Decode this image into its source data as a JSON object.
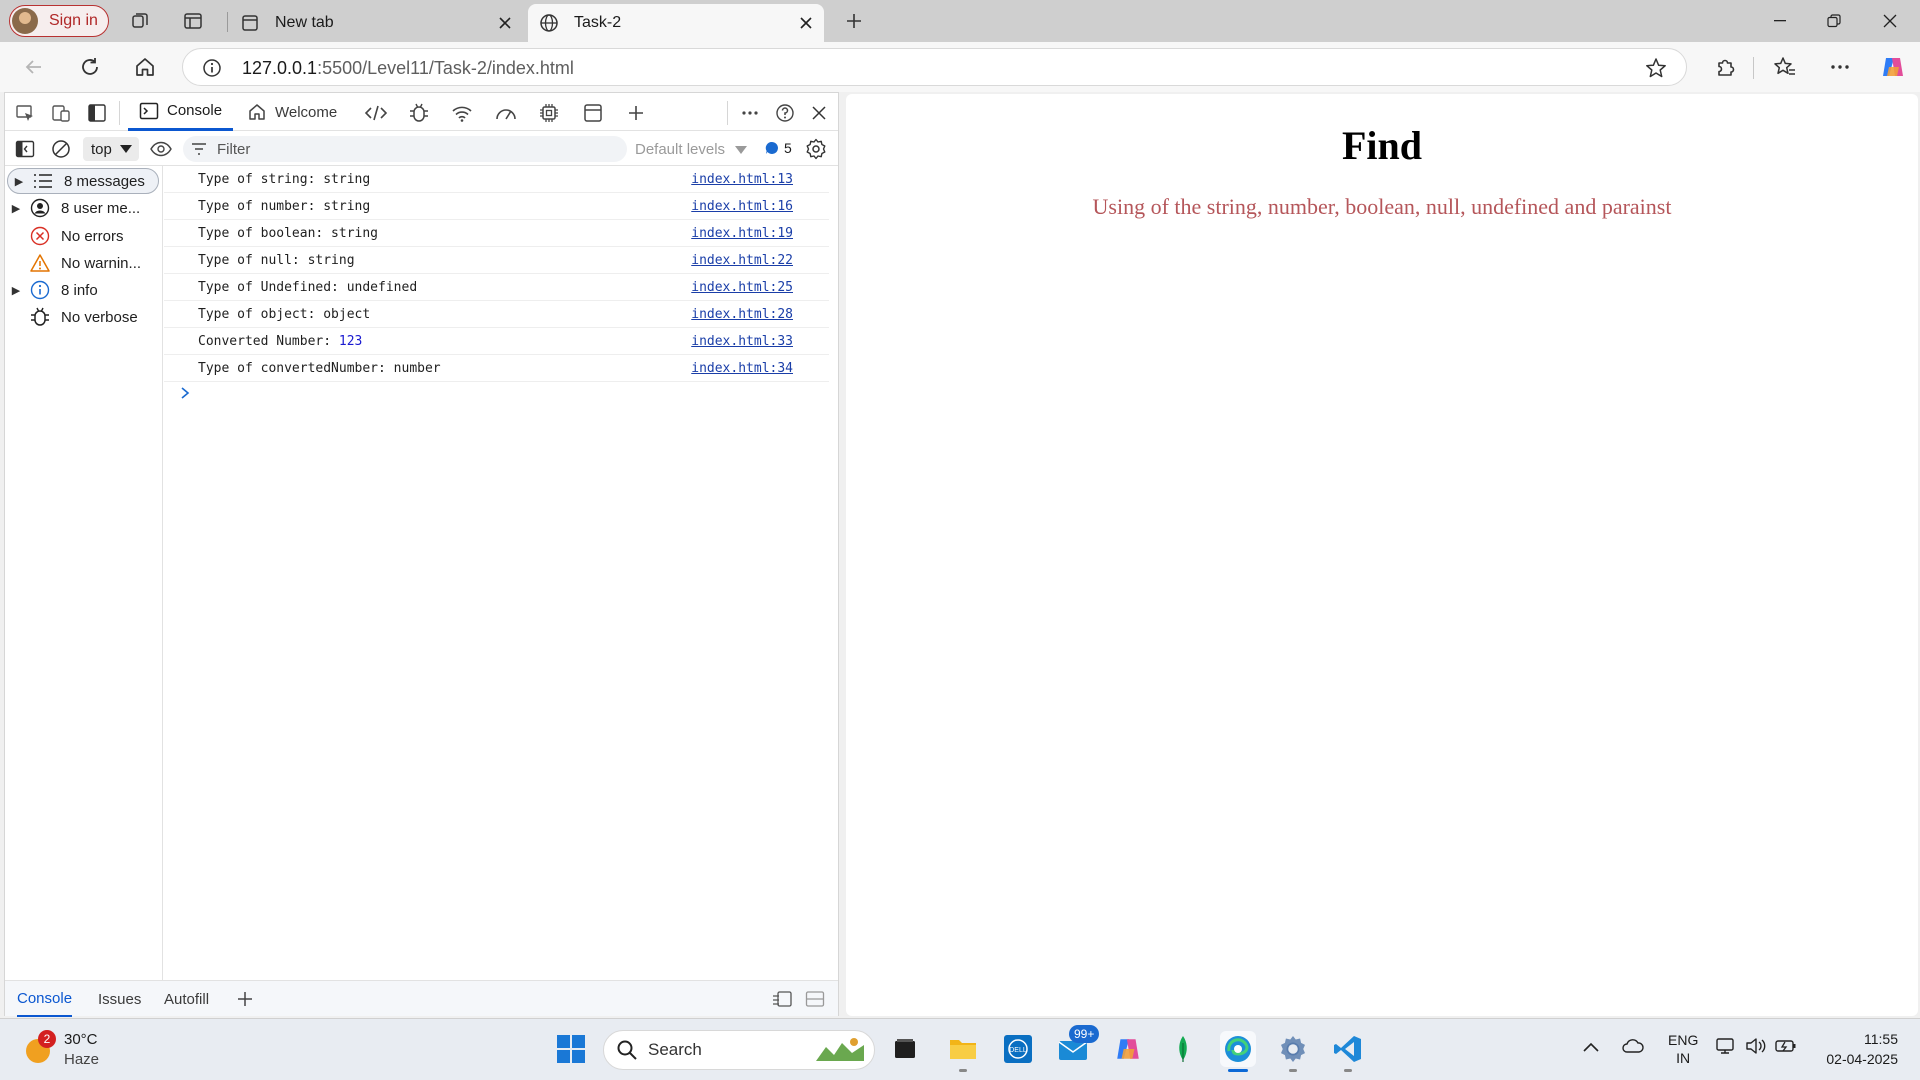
{
  "browser": {
    "signin_label": "Sign in",
    "tabs": [
      {
        "title": "New tab",
        "active": false
      },
      {
        "title": "Task-2",
        "active": true
      }
    ],
    "url_host": "127.0.0.1",
    "url_rest": ":5500/Level11/Task-2/index.html"
  },
  "devtools": {
    "tabs": [
      {
        "label": "Console",
        "active": true
      },
      {
        "label": "Welcome",
        "active": false
      }
    ],
    "context": "top",
    "filter_placeholder": "Filter",
    "levels_label": "Default levels",
    "issues_count": "5",
    "sidebar": [
      {
        "label": "8 messages",
        "icon": "list-icon",
        "expandable": true,
        "selected": true
      },
      {
        "label": "8 user me...",
        "icon": "user-icon",
        "expandable": true,
        "selected": false
      },
      {
        "label": "No errors",
        "icon": "error-icon",
        "expandable": false,
        "selected": false
      },
      {
        "label": "No warnin...",
        "icon": "warning-icon",
        "expandable": false,
        "selected": false
      },
      {
        "label": "8 info",
        "icon": "info-icon",
        "expandable": true,
        "selected": false
      },
      {
        "label": "No verbose",
        "icon": "bug-icon",
        "expandable": false,
        "selected": false
      }
    ],
    "log": [
      {
        "text": "Type of string: string",
        "source": "index.html:13"
      },
      {
        "text": "Type of number: string",
        "source": "index.html:16"
      },
      {
        "text": "Type of boolean: string",
        "source": "index.html:19"
      },
      {
        "text": "Type of null: string",
        "source": "index.html:22"
      },
      {
        "text": "Type of Undefined: undefined",
        "source": "index.html:25"
      },
      {
        "text": "Type of object: object",
        "source": "index.html:28"
      },
      {
        "text": "Converted Number: ",
        "number": "123",
        "source": "index.html:33"
      },
      {
        "text": "Type of convertedNumber: number",
        "source": "index.html:34"
      }
    ],
    "drawer_tabs": [
      "Console",
      "Issues",
      "Autofill"
    ]
  },
  "page": {
    "heading": "Find",
    "paragraph": "Using of the string, number, boolean, null, undefined and parainst"
  },
  "taskbar": {
    "weather_temp": "30°C",
    "weather_cond": "Haze",
    "weather_badge": "2",
    "search_label": "Search",
    "mail_badge": "99+",
    "lang_top": "ENG",
    "lang_bottom": "IN",
    "time": "11:55",
    "date": "02-04-2025"
  },
  "colors": {
    "accent": "#0b57d0",
    "signin_red": "#b02828",
    "paragraph": "#b5565a"
  }
}
